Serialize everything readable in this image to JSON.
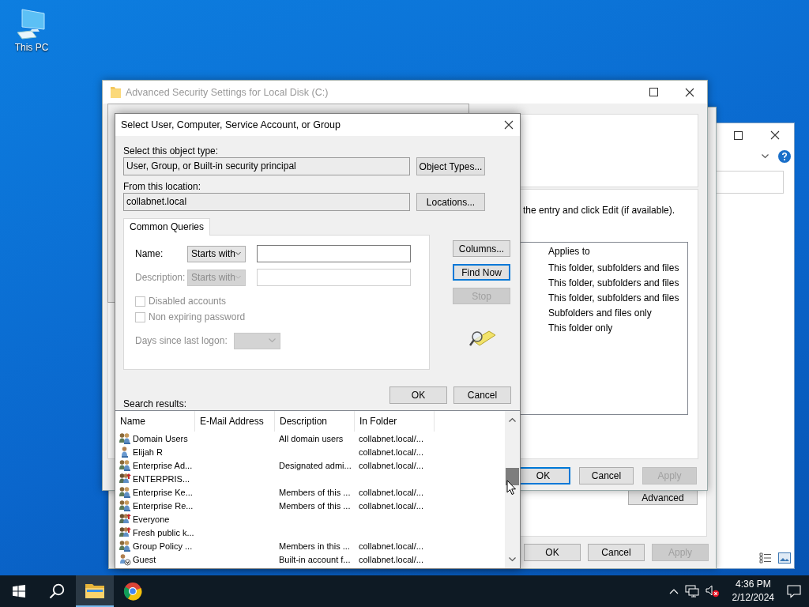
{
  "desktop": {
    "icons": [
      {
        "label": "This PC"
      }
    ]
  },
  "properties_window": {
    "advanced_button": "Advanced",
    "buttons": [
      {
        "label": "OK",
        "disabled": false
      },
      {
        "label": "Cancel",
        "disabled": false
      },
      {
        "label": "Apply",
        "disabled": true
      }
    ]
  },
  "security_window": {
    "title": "Advanced Security Settings for Local Disk (C:)",
    "instruction": "the entry and click Edit (if available).",
    "entries": {
      "columns": [
        "Applies to"
      ],
      "rows": [
        "This folder, subfolders and files",
        "This folder, subfolders and files",
        "This folder, subfolders and files",
        "Subfolders and files only",
        "This folder only"
      ]
    },
    "buttons": [
      {
        "label": "OK",
        "focused": true,
        "disabled": false
      },
      {
        "label": "Cancel",
        "focused": false,
        "disabled": false
      },
      {
        "label": "Apply",
        "focused": false,
        "disabled": true
      }
    ]
  },
  "select_dialog": {
    "title": "Select User, Computer, Service Account, or Group",
    "object_type_label": "Select this object type:",
    "object_type": "User, Group, or Built-in security principal",
    "object_types_button": "Object Types...",
    "location_label": "From this location:",
    "location": "collabnet.local",
    "locations_button": "Locations...",
    "tabs": [
      {
        "label": "Common Queries",
        "selected": true
      }
    ],
    "queries": {
      "name_label": "Name:",
      "name_match": "Starts with",
      "description_label": "Description:",
      "description_match": "Starts with",
      "description_disabled": true,
      "checkboxes": [
        {
          "label": "Disabled accounts",
          "checked": false,
          "disabled": true
        },
        {
          "label": "Non expiring password",
          "checked": false,
          "disabled": true
        }
      ],
      "days_label": "Days since last logon:",
      "days_disabled": true
    },
    "side_buttons": [
      {
        "label": "Columns...",
        "focused": false,
        "disabled": false
      },
      {
        "label": "Find Now",
        "focused": true,
        "disabled": false
      },
      {
        "label": "Stop",
        "focused": false,
        "disabled": true
      }
    ],
    "buttons": [
      {
        "label": "OK"
      },
      {
        "label": "Cancel"
      }
    ],
    "results_label": "Search results:",
    "results": {
      "columns": [
        "Name",
        "E-Mail Address",
        "Description",
        "In Folder"
      ],
      "rows": [
        {
          "kind": "group",
          "name": "Domain Users",
          "description": "All domain users",
          "folder": "collabnet.local/..."
        },
        {
          "kind": "user",
          "name": "Elijah R",
          "folder": "collabnet.local/..."
        },
        {
          "kind": "group",
          "name": "Enterprise Ad...",
          "description": "Designated admi...",
          "folder": "collabnet.local/..."
        },
        {
          "kind": "special",
          "name": "ENTERPRIS..."
        },
        {
          "kind": "group",
          "name": "Enterprise Ke...",
          "description": "Members of this ...",
          "folder": "collabnet.local/..."
        },
        {
          "kind": "group",
          "name": "Enterprise Re...",
          "description": "Members of this ...",
          "folder": "collabnet.local/..."
        },
        {
          "kind": "special",
          "name": "Everyone"
        },
        {
          "kind": "special",
          "name": "Fresh public k..."
        },
        {
          "kind": "group",
          "name": "Group Policy ...",
          "description": "Members in this ...",
          "folder": "collabnet.local/..."
        },
        {
          "kind": "disabled-user",
          "name": "Guest",
          "description": "Built-in account f...",
          "folder": "collabnet.local/..."
        }
      ]
    }
  },
  "taskbar": {
    "apps": [
      {
        "kind": "explorer",
        "selected": true
      },
      {
        "kind": "browser",
        "selected": false
      }
    ],
    "volume_muted": true,
    "time": "4:36 PM",
    "date": "2/12/2024"
  }
}
